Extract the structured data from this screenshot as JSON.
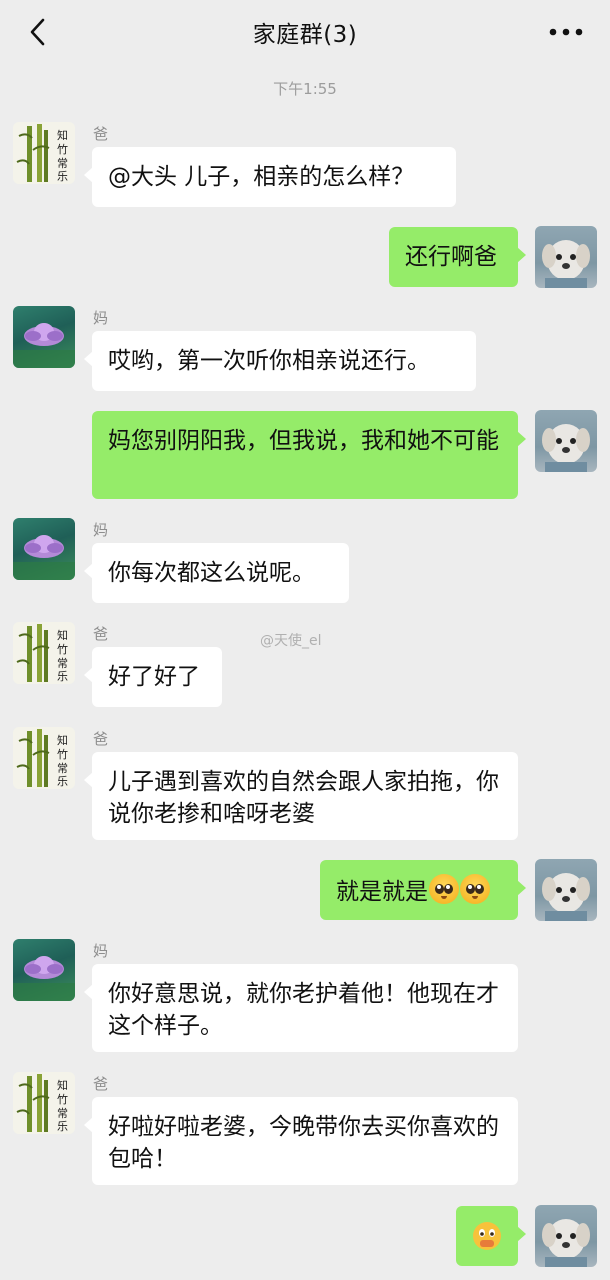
{
  "header": {
    "title": "家庭群(3)",
    "back_icon": "chevron-left-icon",
    "more_icon": "more-dots-icon"
  },
  "timestamp": "下午1:55",
  "watermark": "@天使_el",
  "colors": {
    "background": "#ededed",
    "incoming_bubble": "#ffffff",
    "outgoing_bubble": "#95ec69",
    "sender_name": "#8d8d8d",
    "timestamp": "#9c9c9c"
  },
  "messages": [
    {
      "direction": "in",
      "sender": "爸",
      "avatar": "bamboo-avatar",
      "text": "@大头 儿子，相亲的怎么样？"
    },
    {
      "direction": "out",
      "avatar": "dog-avatar",
      "text": "还行啊爸"
    },
    {
      "direction": "in",
      "sender": "妈",
      "avatar": "lotus-avatar",
      "text": "哎哟，第一次听你相亲说还行。"
    },
    {
      "direction": "out",
      "avatar": "dog-avatar",
      "text": "妈您别阴阳我，但我说，我和她不可能"
    },
    {
      "direction": "in",
      "sender": "妈",
      "avatar": "lotus-avatar",
      "text": "你每次都这么说呢。"
    },
    {
      "direction": "in",
      "sender": "爸",
      "avatar": "bamboo-avatar",
      "text": "好了好了"
    },
    {
      "direction": "in",
      "sender": "爸",
      "avatar": "bamboo-avatar",
      "text": "儿子遇到喜欢的自然会跟人家拍拖，你说你老掺和啥呀老婆"
    },
    {
      "direction": "out",
      "avatar": "dog-avatar",
      "text": "就是就是",
      "emoji": [
        "pleading-face-emoji",
        "pleading-face-emoji"
      ]
    },
    {
      "direction": "in",
      "sender": "妈",
      "avatar": "lotus-avatar",
      "text": "你好意思说，就你老护着他！他现在才这个样子。"
    },
    {
      "direction": "in",
      "sender": "爸",
      "avatar": "bamboo-avatar",
      "text": "好啦好啦老婆，今晚带你去买你喜欢的包哈！"
    },
    {
      "direction": "out",
      "avatar": "dog-avatar",
      "text": "",
      "emoji": [
        "face-with-hand-emoji"
      ]
    }
  ]
}
